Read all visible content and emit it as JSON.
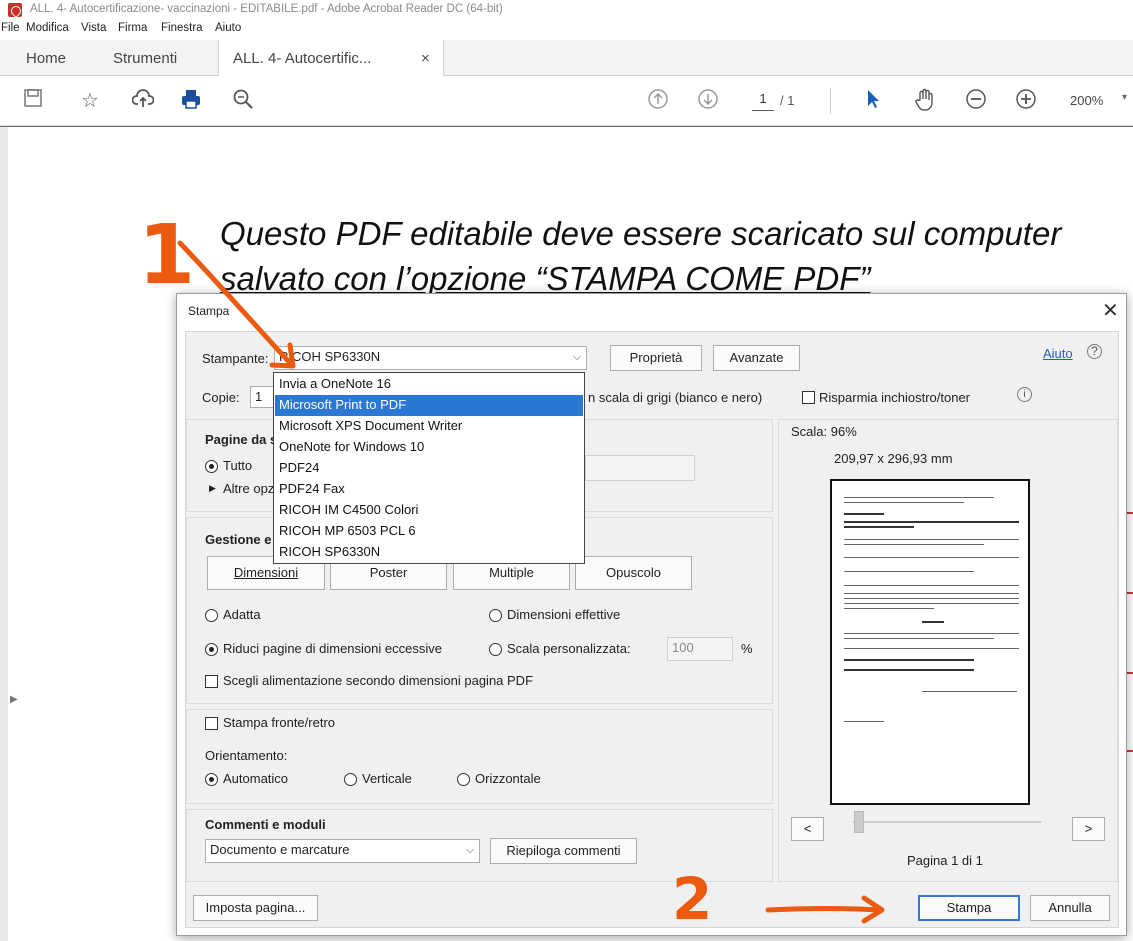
{
  "window": {
    "title": "ALL. 4- Autocertificazione- vaccinazioni - EDITABILE.pdf - Adobe Acrobat Reader DC (64-bit)"
  },
  "menu": [
    "File",
    "Modifica",
    "Vista",
    "Firma",
    "Finestra",
    "Aiuto"
  ],
  "tabs": {
    "home": "Home",
    "tools": "Strumenti",
    "document": "ALL. 4- Autocertific...",
    "close": "×"
  },
  "toolbar": {
    "page_current": "1",
    "page_total": "/ 1",
    "zoom": "200%"
  },
  "document": {
    "line1": "Questo PDF editabile deve essere scaricato sul computer",
    "line2": "salvato con l’opzione “STAMPA COME PDF”"
  },
  "dialog": {
    "title": "Stampa",
    "printer_label": "Stampante:",
    "printer_value": "RICOH SP6330N",
    "properties_button": "Proprietà",
    "advanced_button": "Avanzate",
    "help_link": "Aiuto",
    "copies_label": "Copie:",
    "copies_value": "1",
    "grayscale_label": "n scala di grigi (bianco e nero)",
    "save_ink_label": "Risparmia inchiostro/toner",
    "pages_header": "Pagine da s",
    "all_label": "Tutto",
    "more_options": "Altre opz",
    "handling_header": "Gestione e",
    "size_button": "Dimensioni",
    "poster_button": "Poster",
    "multiple_button": "Multiple",
    "booklet_button": "Opuscolo",
    "fit_label": "Adatta",
    "actual_size_label": "Dimensioni effettive",
    "shrink_label": "Riduci pagine di dimensioni eccessive",
    "custom_scale_label": "Scala personalizzata:",
    "custom_scale_value": "100",
    "percent": "%",
    "paper_source_label": "Scegli alimentazione secondo dimensioni pagina PDF",
    "duplex_label": "Stampa fronte/retro",
    "orientation_label": "Orientamento:",
    "auto_label": "Automatico",
    "portrait_label": "Verticale",
    "landscape_label": "Orizzontale",
    "comments_header": "Commenti e moduli",
    "comments_value": "Documento e marcature",
    "summarize_button": "Riepiloga commenti",
    "scale_label": "Scala:  96%",
    "paper_size": "209,97 x 296,93 mm",
    "prev_button": "<",
    "next_button": ">",
    "page_of": "Pagina 1 di 1",
    "page_setup_button": "Imposta pagina...",
    "print_button": "Stampa",
    "cancel_button": "Annulla",
    "printer_list": [
      "Invia a OneNote 16",
      "Microsoft Print to PDF",
      "Microsoft XPS Document Writer",
      "OneNote for Windows 10",
      "PDF24",
      "PDF24 Fax",
      "RICOH IM C4500 Colori",
      "RICOH MP 6503 PCL 6",
      "RICOH SP6330N"
    ],
    "printer_list_selected": 1
  },
  "annotations": {
    "step1": "1",
    "step2": "2",
    "color": "#ec5a10"
  }
}
